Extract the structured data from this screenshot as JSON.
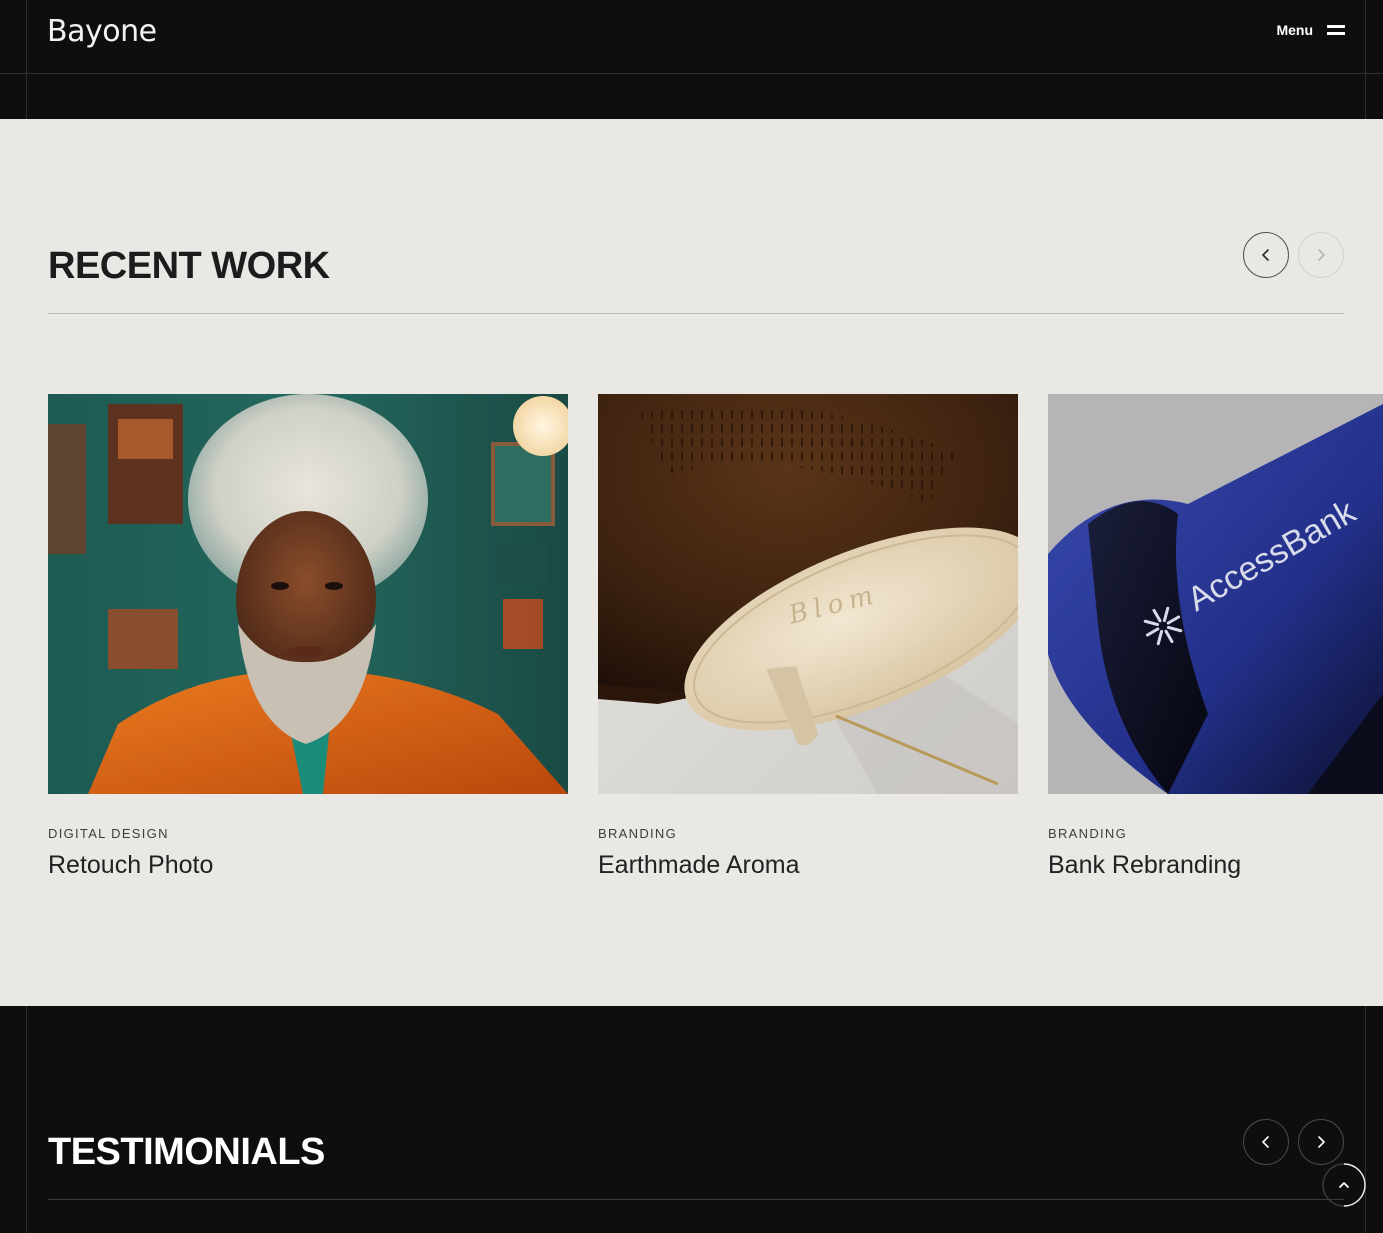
{
  "header": {
    "logo": "Bayone",
    "menu_label": "Menu"
  },
  "recent_work": {
    "title": "RECENT WORK",
    "cards": [
      {
        "category": "DIGITAL DESIGN",
        "title": "Retouch Photo"
      },
      {
        "category": "BRANDING",
        "title": "Earthmade Aroma",
        "image_text": "Blom"
      },
      {
        "category": "BRANDING",
        "title": "Bank Rebranding",
        "image_text": "AccessBank"
      }
    ]
  },
  "testimonials": {
    "title": "TESTIMONIALS"
  },
  "icons": {
    "prev": "chevron-left-icon",
    "next": "chevron-right-icon",
    "menu": "hamburger-icon",
    "scroll_top": "chevron-up-icon"
  },
  "colors": {
    "dark_bg": "#0e0e0f",
    "light_bg": "#e9e8e4",
    "text_dark": "#1c1c1d",
    "text_light": "#ffffff"
  }
}
